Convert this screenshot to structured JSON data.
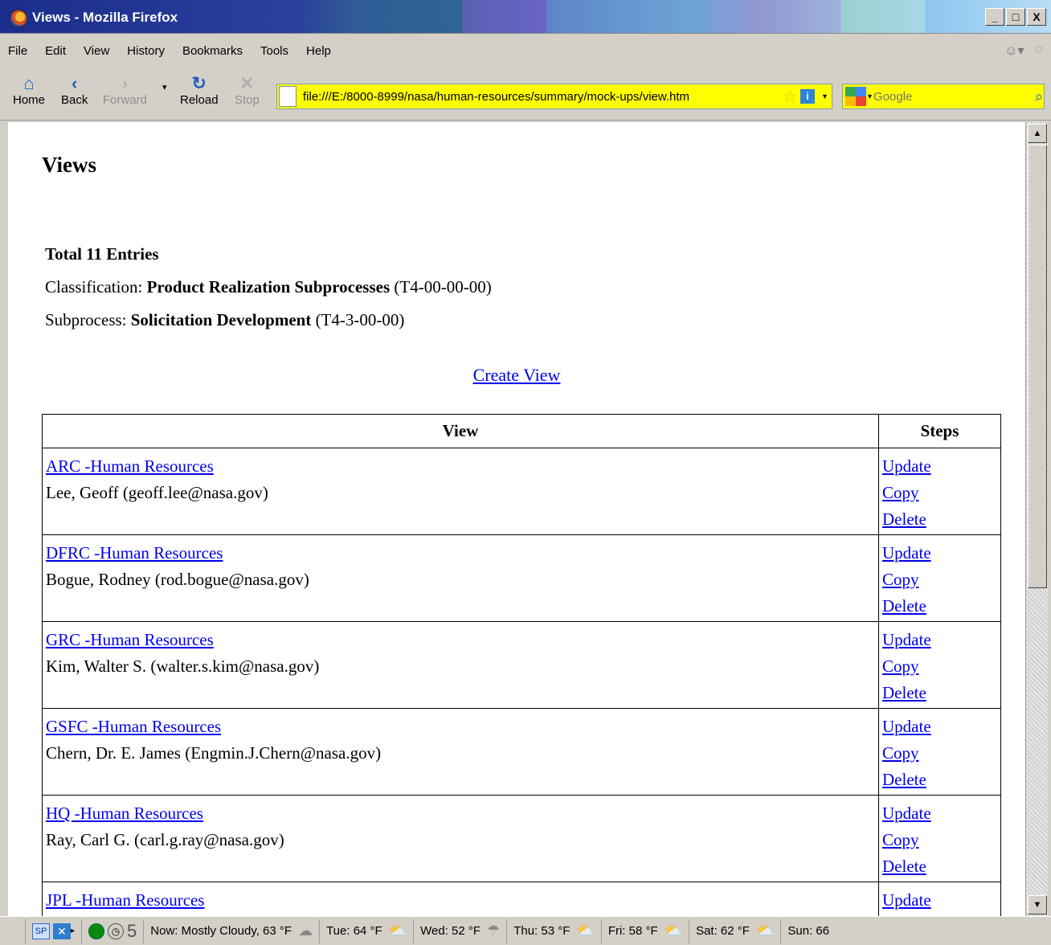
{
  "window": {
    "title": "Views - Mozilla Firefox"
  },
  "window_buttons": {
    "minimize": "_",
    "maximize": "□",
    "close": "X"
  },
  "menu": [
    "File",
    "Edit",
    "View",
    "History",
    "Bookmarks",
    "Tools",
    "Help"
  ],
  "nav": {
    "home": "Home",
    "back": "Back",
    "forward": "Forward",
    "reload": "Reload",
    "stop": "Stop"
  },
  "url": "file:///E:/8000-8999/nasa/human-resources/summary/mock-ups/view.htm",
  "search": {
    "placeholder": "Google"
  },
  "page": {
    "heading": "Views",
    "total": "Total 11 Entries",
    "classification": {
      "label": "Classification: ",
      "name": "Product Realization Subprocesses",
      "code": " (T4-00-00-00)"
    },
    "subprocess": {
      "label": "Subprocess: ",
      "name": "Solicitation Development",
      "code": " (T4-3-00-00)"
    },
    "create_view": "Create View",
    "table": {
      "headers": {
        "view": "View",
        "steps": "Steps"
      },
      "step_links": {
        "update": "Update",
        "copy": "Copy",
        "delete": "Delete"
      },
      "rows": [
        {
          "view": "ARC -Human Resources",
          "owner": "Lee, Geoff (geoff.lee@nasa.gov)"
        },
        {
          "view": "DFRC -Human Resources",
          "owner": "Bogue, Rodney (rod.bogue@nasa.gov)"
        },
        {
          "view": "GRC -Human Resources",
          "owner": "Kim, Walter S. (walter.s.kim@nasa.gov)"
        },
        {
          "view": "GSFC -Human Resources",
          "owner": "Chern, Dr. E. James (Engmin.J.Chern@nasa.gov)"
        },
        {
          "view": "HQ -Human Resources",
          "owner": "Ray, Carl G. (carl.g.ray@nasa.gov)"
        },
        {
          "view": "JPL -Human Resources",
          "owner": ""
        }
      ]
    }
  },
  "statusbar": {
    "sp": "SP",
    "five": "5",
    "weather": [
      "Now: Mostly Cloudy, 63 °F",
      "Tue: 64 °F",
      "Wed: 52 °F",
      "Thu: 53 °F",
      "Fri: 58 °F",
      "Sat: 62 °F",
      "Sun: 66"
    ]
  }
}
